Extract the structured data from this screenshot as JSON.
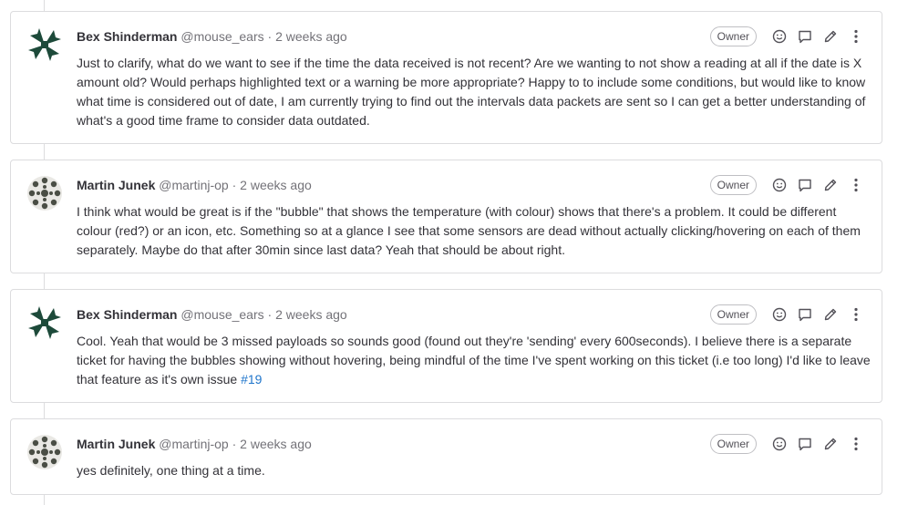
{
  "notes": [
    {
      "author": "Bex Shinderman",
      "handle": "@mouse_ears",
      "separator": "·",
      "time": "2 weeks ago",
      "badge": "Owner",
      "body": "Just to clarify, what do we want to see if the time the data received is not recent? Are we wanting to not show a reading at all if the date is X amount old? Would perhaps highlighted text or a warning be more appropriate? Happy to to include some conditions, but would like to know what time is considered out of date, I am currently trying to find out the intervals data packets are sent so I can get a better understanding of what's a good time frame to consider data outdated."
    },
    {
      "author": "Martin Junek",
      "handle": "@martinj-op",
      "separator": "·",
      "time": "2 weeks ago",
      "badge": "Owner",
      "body": "I think what would be great is if the \"bubble\" that shows the temperature (with colour) shows that there's a problem. It could be different colour (red?) or an icon, etc. Something so at a glance I see that some sensors are dead without actually clicking/hovering on each of them separately. Maybe do that after 30min since last data? Yeah that should be about right."
    },
    {
      "author": "Bex Shinderman",
      "handle": "@mouse_ears",
      "separator": "·",
      "time": "2 weeks ago",
      "badge": "Owner",
      "body": "Cool. Yeah that would be 3 missed payloads so sounds good (found out they're 'sending' every 600seconds). I believe there is a separate ticket for having the bubbles showing without hovering, being mindful of the time I've spent working on this ticket (i.e too long) I'd like to leave that feature as it's own issue ",
      "link": "#19"
    },
    {
      "author": "Martin Junek",
      "handle": "@martinj-op",
      "separator": "·",
      "time": "2 weeks ago",
      "badge": "Owner",
      "body": "yes definitely, one thing at a time."
    }
  ],
  "icons": {
    "reaction": "smiley-icon",
    "reply": "comment-icon",
    "edit": "pencil-icon",
    "more": "vertical-ellipsis-icon"
  },
  "colors": {
    "link": "#1f75cb",
    "text": "#333238",
    "muted": "#737278",
    "border": "#dcdcde",
    "avatar_bex": "#1d4a3a",
    "avatar_martin": "#4a4e45"
  }
}
